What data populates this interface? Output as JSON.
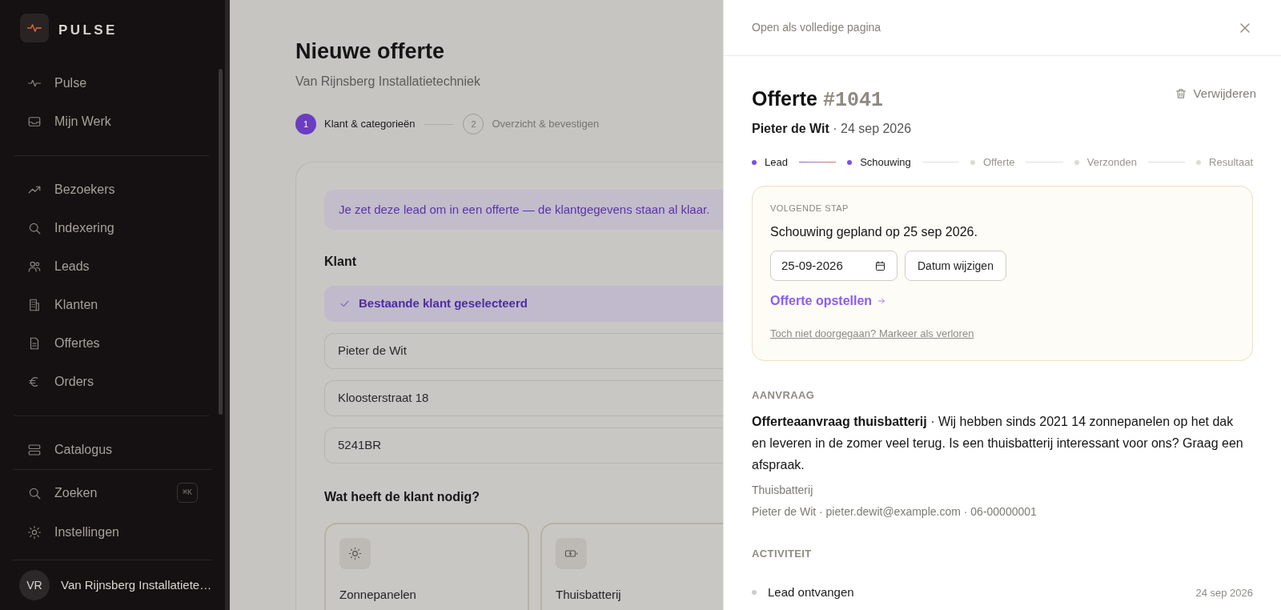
{
  "sidebar": {
    "brand": "PULSE",
    "groups": [
      [
        {
          "kind": "pulse",
          "label": "Pulse"
        },
        {
          "kind": "inbox",
          "label": "Mijn Werk"
        }
      ],
      [
        {
          "kind": "trend",
          "label": "Bezoekers"
        },
        {
          "kind": "search",
          "label": "Indexering"
        },
        {
          "kind": "users",
          "label": "Leads"
        },
        {
          "kind": "building",
          "label": "Klanten"
        },
        {
          "kind": "document",
          "label": "Offertes"
        },
        {
          "kind": "euro",
          "label": "Orders"
        }
      ],
      [
        {
          "kind": "catalog",
          "label": "Catalogus"
        }
      ]
    ],
    "footer_items": [
      {
        "kind": "search",
        "label": "Zoeken",
        "shortcut": "⌘K"
      },
      {
        "kind": "gear",
        "label": "Instellingen"
      }
    ],
    "user": {
      "initials": "VR",
      "name": "Van Rijnsberg Installatiete…"
    }
  },
  "main": {
    "title": "Nieuwe offerte",
    "subtitle": "Van Rijnsberg Installatietechniek",
    "steps": [
      {
        "number": "1",
        "label": "Klant & categorieën",
        "selected": true
      },
      {
        "number": "2",
        "label": "Overzicht & bevestigen",
        "selected": false
      }
    ],
    "info": "Je zet deze lead om in een offerte — de klantgegevens staan al klaar.",
    "customer_heading": "Klant",
    "customer_status": "Bestaande klant geselecteerd",
    "fields": [
      {
        "value": "Pieter de Wit"
      },
      {
        "value": "Kloosterstraat 18"
      },
      {
        "value": "5241BR"
      }
    ],
    "needs_heading": "Wat heeft de klant nodig?",
    "categories": [
      {
        "kind": "solar",
        "label": "Zonnepanelen"
      },
      {
        "kind": "battery",
        "label": "Thuisbatterij"
      }
    ]
  },
  "drawer": {
    "open_full": "Open als volledige pagina",
    "title": "Offerte",
    "number": "#1041",
    "delete": "Verwijderen",
    "customer": "Pieter de Wit",
    "date": "· 24 sep 2026",
    "pipeline": [
      {
        "label": "Lead",
        "reached": true
      },
      {
        "label": "Schouwing",
        "reached": true
      },
      {
        "label": "Offerte",
        "reached": false
      },
      {
        "label": "Verzonden",
        "reached": false
      },
      {
        "label": "Resultaat",
        "reached": false
      }
    ],
    "next_step": {
      "heading": "VOLGENDE STAP",
      "text": "Schouwing gepland op 25 sep 2026.",
      "date_value": "25-09-2026",
      "change_button": "Datum wijzigen",
      "action_link": "Offerte opstellen",
      "lost_link": "Toch niet doorgegaan? Markeer als verloren"
    },
    "request": {
      "heading": "AANVRAAG",
      "text": "**Offerteaanvraag thuisbatterij** · Wij hebben sinds 2021 14 zonnepanelen op het dak en leveren in de zomer veel terug. Is een thuisbatterij interessant voor ons? Graag een afspraak.",
      "category": "Thuisbatterij",
      "contact": "Pieter de Wit · pieter.dewit@example.com · 06-00000001"
    },
    "activity": {
      "heading": "ACTIVITEIT",
      "items": [
        {
          "label": "Lead ontvangen",
          "date": "24 sep 2026"
        }
      ]
    }
  }
}
